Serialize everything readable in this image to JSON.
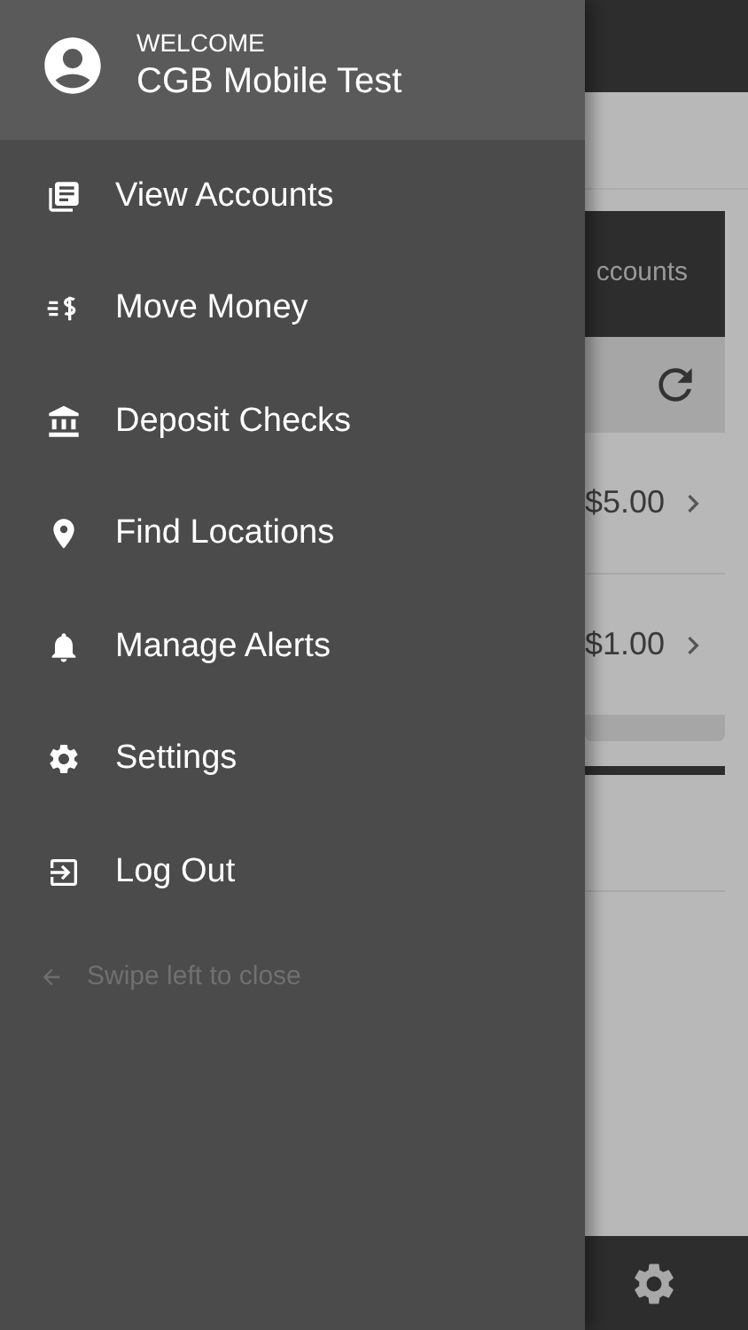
{
  "drawer": {
    "greeting": "WELCOME",
    "user_name": "CGB Mobile Test",
    "items": [
      {
        "label": "View Accounts",
        "kind": "accounts"
      },
      {
        "label": "Move Money",
        "kind": "transfer"
      },
      {
        "label": "Deposit Checks",
        "kind": "bank"
      },
      {
        "label": "Find Locations",
        "kind": "location"
      },
      {
        "label": "Manage Alerts",
        "kind": "alerts"
      },
      {
        "label": "Settings",
        "kind": "settings"
      },
      {
        "label": "Log Out",
        "kind": "logout"
      }
    ],
    "hint": "Swipe left to close"
  },
  "background": {
    "card_title": "ccounts",
    "rows": [
      {
        "amount": "$5.00"
      },
      {
        "amount": "$1.00"
      }
    ]
  }
}
